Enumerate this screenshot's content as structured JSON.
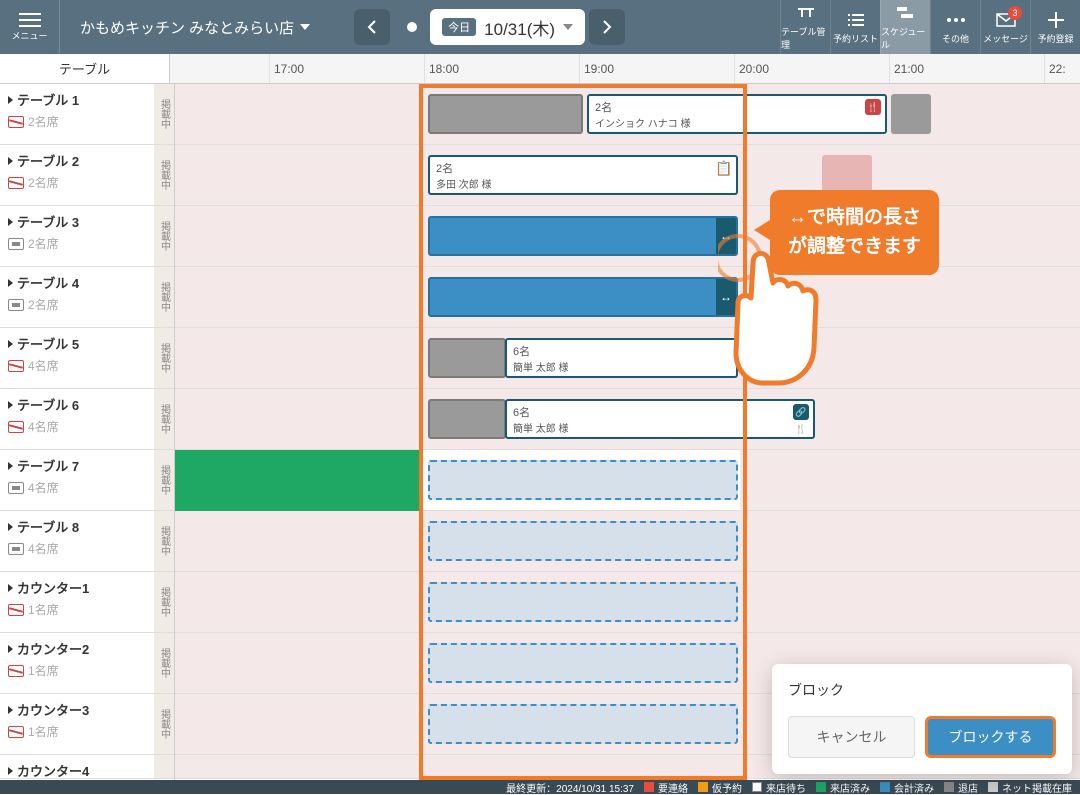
{
  "header": {
    "menu_label": "メニュー",
    "store_name": "かもめキッチン みなとみらい店",
    "today_label": "今日",
    "date_text": "10/31(木)",
    "nav": [
      {
        "label": "テーブル管理"
      },
      {
        "label": "予約リスト"
      },
      {
        "label": "スケジュール"
      },
      {
        "label": "その他"
      },
      {
        "label": "メッセージ",
        "badge": "3"
      },
      {
        "label": "予約登録"
      }
    ]
  },
  "table_header": "テーブル",
  "times": [
    "17:00",
    "18:00",
    "19:00",
    "20:00",
    "21:00",
    "22:"
  ],
  "tables": [
    {
      "name": "テーブル 1",
      "seats": "2名席",
      "status": "掲載中"
    },
    {
      "name": "テーブル 2",
      "seats": "2名席",
      "status": "掲載中"
    },
    {
      "name": "テーブル 3",
      "seats": "2名席",
      "status": "掲載中"
    },
    {
      "name": "テーブル 4",
      "seats": "2名席",
      "status": "掲載中"
    },
    {
      "name": "テーブル 5",
      "seats": "4名席",
      "status": "掲載中"
    },
    {
      "name": "テーブル 6",
      "seats": "4名席",
      "status": "掲載中"
    },
    {
      "name": "テーブル 7",
      "seats": "4名席",
      "status": "掲載中"
    },
    {
      "name": "テーブル 8",
      "seats": "4名席",
      "status": "掲載中"
    },
    {
      "name": "カウンター1",
      "seats": "1名席",
      "status": "掲載中"
    },
    {
      "name": "カウンター2",
      "seats": "1名席",
      "status": "掲載中"
    },
    {
      "name": "カウンター3",
      "seats": "1名席",
      "status": "掲載中"
    },
    {
      "name": "カウンター4",
      "seats": "",
      "status": ""
    }
  ],
  "reservations": {
    "r1a_guests": "2名",
    "r1a_name": "インショク ハナコ 様",
    "r2_guests": "2名",
    "r2_name": "多田 次郎 様",
    "r5_guests": "6名",
    "r5_name": "簡単 太郎 様",
    "r6_guests": "6名",
    "r6_name": "簡単 太郎 様"
  },
  "tooltip_line1": "↔で時間の長さ",
  "tooltip_line2": "が調整できます",
  "dialog": {
    "title": "ブロック",
    "cancel": "キャンセル",
    "confirm": "ブロックする"
  },
  "footer": {
    "updated": "最終更新：2024/10/31 15:37",
    "legend": [
      {
        "color": "#e74c3c",
        "label": "要連絡"
      },
      {
        "color": "#f39c12",
        "label": "仮予約"
      },
      {
        "color": "#ffffff",
        "label": "来店待ち"
      },
      {
        "color": "#1fa764",
        "label": "来店済み"
      },
      {
        "color": "#3b8fc4",
        "label": "会計済み"
      },
      {
        "color": "#888888",
        "label": "退店"
      },
      {
        "color": "#cccccc",
        "label": "ネット掲載在庫"
      }
    ]
  }
}
